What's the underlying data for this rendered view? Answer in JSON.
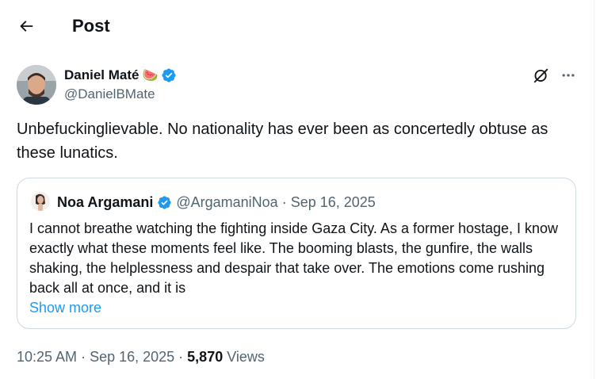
{
  "header": {
    "title": "Post"
  },
  "author": {
    "name": "Daniel Maté",
    "emoji": "🍉",
    "handle": "@DanielBMate"
  },
  "post": {
    "text": "Unbefuckinglievable. No nationality has ever been as concertedly obtuse as these lunatics."
  },
  "quote": {
    "name": "Noa Argamani",
    "handle": "@ArgamaniNoa",
    "separator": "·",
    "date": "Sep 16, 2025",
    "text": "I cannot breathe watching the fighting inside Gaza City. As a former hostage, I know exactly what these moments feel like. The booming blasts, the gunfire, the walls shaking, the helplessness and despair that take over. The emotions come rushing back all at once, and it is",
    "show_more": "Show more"
  },
  "meta": {
    "time": "10:25 AM",
    "separator": " · ",
    "date": "Sep 16, 2025",
    "views_count": "5,870",
    "views_label": " Views"
  },
  "colors": {
    "verified": "#1d9bf0",
    "link": "#1d9bf0",
    "secondary_text": "#536471",
    "border": "#cfd9de"
  },
  "icons": {
    "back": "arrow-left-icon",
    "verified": "verified-badge-icon",
    "grok": "grok-icon",
    "more": "more-horizontal-icon"
  }
}
